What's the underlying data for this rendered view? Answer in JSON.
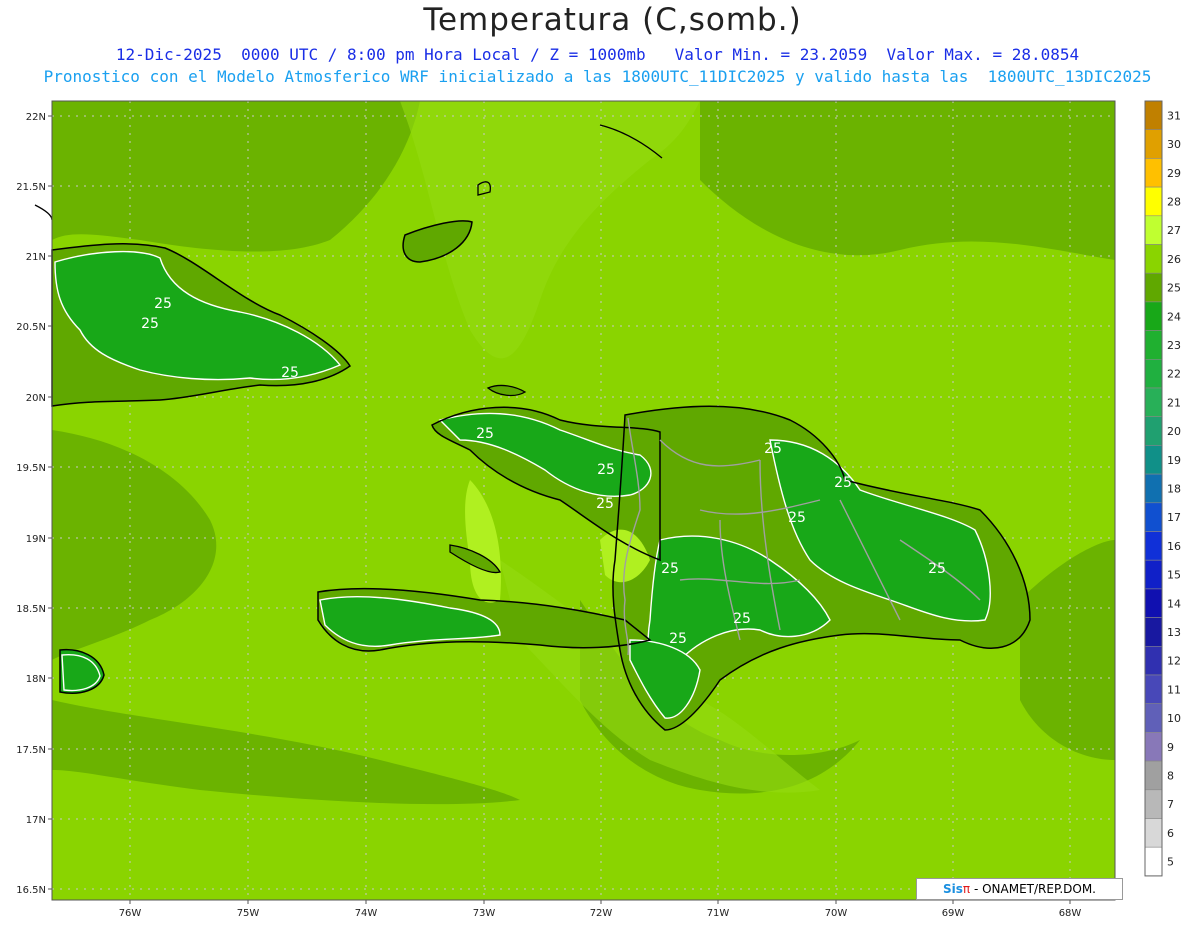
{
  "title": "Temperatura (C,somb.)",
  "subtitle_line1": "12-Dic-2025  0000 UTC / 8:00 pm Hora Local / Z = 1000mb   Valor Min. = 23.2059  Valor Max. = 28.0854",
  "subtitle_line2": "Pronostico con el Modelo Atmosferico WRF inicializado a las 1800UTC_11DIC2025 y valido hasta las  1800UTC_13DIC2025",
  "lat_labels": [
    "22N",
    "21.5N",
    "21N",
    "20.5N",
    "20N",
    "19.5N",
    "19N",
    "18.5N",
    "18N",
    "17.5N",
    "17N",
    "16.5N"
  ],
  "lon_labels": [
    "76W",
    "75W",
    "74W",
    "73W",
    "72W",
    "71W",
    "70W",
    "69W",
    "68W"
  ],
  "contour_labels": [
    "25",
    "25",
    "25",
    "25",
    "25",
    "25",
    "25",
    "25",
    "25",
    "25",
    "25",
    "25",
    "25"
  ],
  "colorbar": {
    "labels": [
      "31",
      "30",
      "29",
      "28",
      "27",
      "26",
      "25",
      "24",
      "23",
      "22",
      "21",
      "20",
      "19",
      "18",
      "17",
      "16",
      "15",
      "14",
      "13",
      "12",
      "11",
      "10",
      "9",
      "8",
      "7",
      "6",
      "5"
    ],
    "colors": [
      "#c08000",
      "#e0a000",
      "#ffc000",
      "#ffff00",
      "#c0ff30",
      "#8ad400",
      "#60a800",
      "#18a818",
      "#20b030",
      "#20b040",
      "#28b058",
      "#20a070",
      "#109088",
      "#1070b0",
      "#1050d0",
      "#1030d8",
      "#1020c8",
      "#1010b0",
      "#1818a0",
      "#3030b0",
      "#4848b8",
      "#6060b8",
      "#8878b8",
      "#a0a0a0",
      "#b8b8b8",
      "#d8d8d8",
      "#ffffff"
    ]
  },
  "legend": {
    "colors": {
      "sea": "#8ad400",
      "land_25": "#18a818",
      "land_26": "#60a800",
      "warm": "#b0f020",
      "coast": "#000000",
      "border": "#a0a0a0",
      "contour": "#ffffff",
      "grid": "#c8c8c8"
    }
  },
  "credit": {
    "brand": "Sis",
    "pi": "π",
    "rest": " - ONAMET/REP.DOM."
  }
}
